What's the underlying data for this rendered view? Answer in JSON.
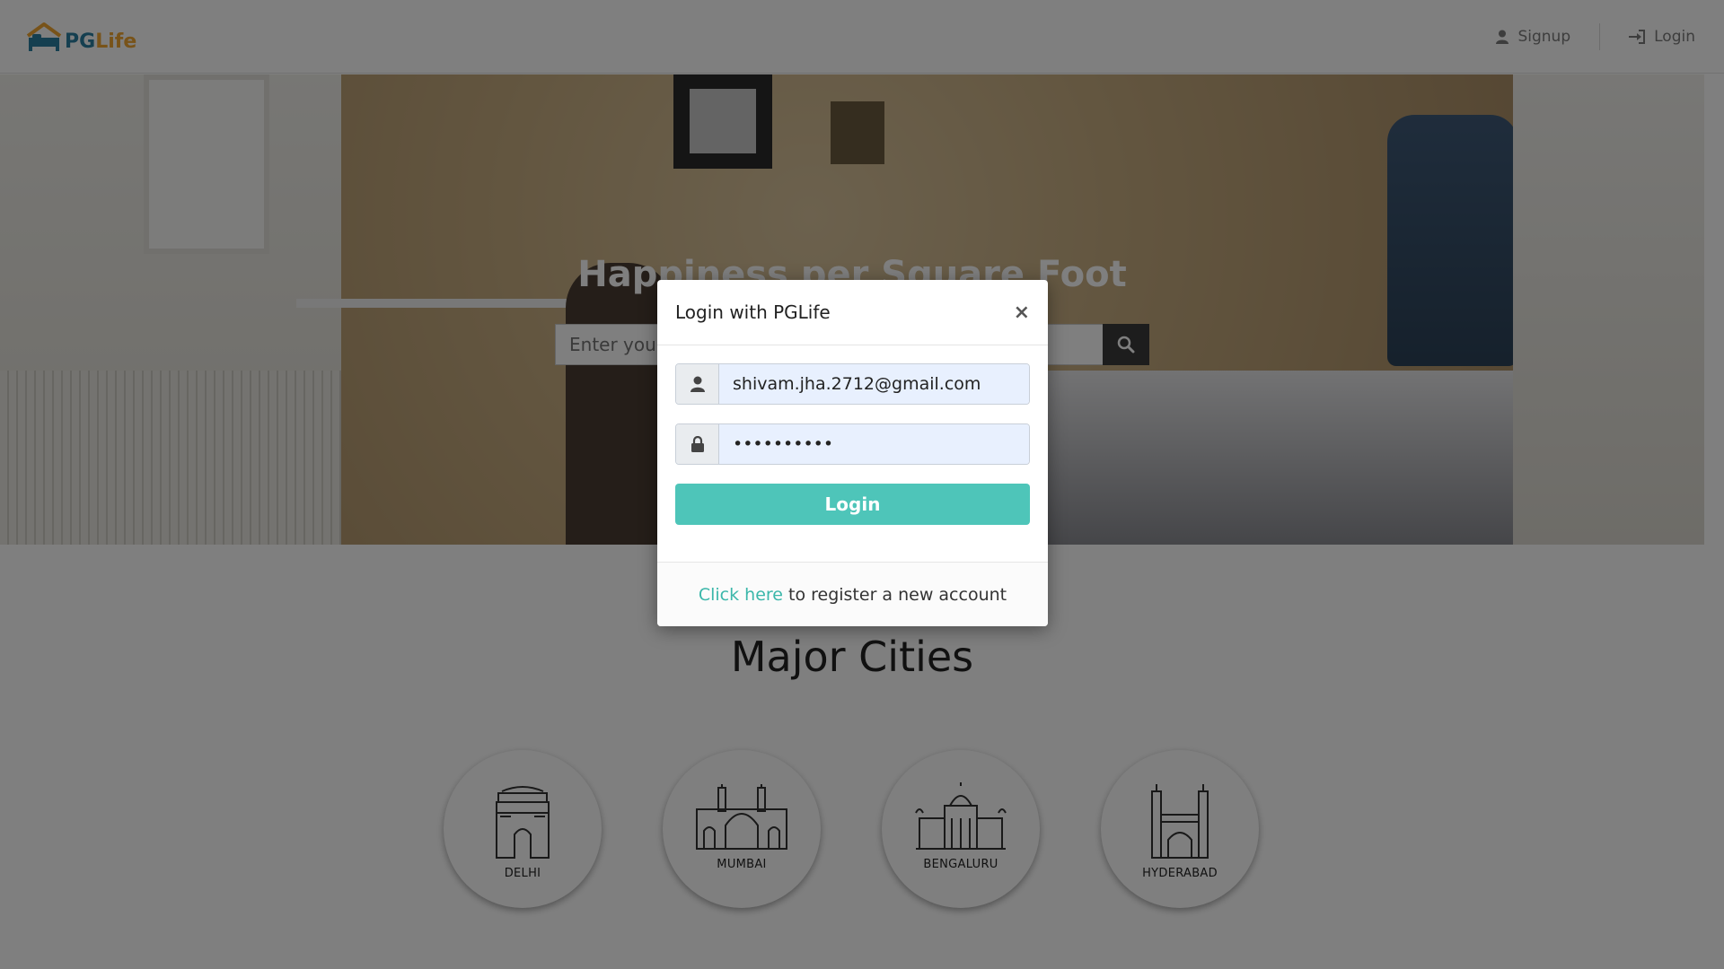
{
  "header": {
    "logo_pg": "PG",
    "logo_life": "Life",
    "nav": {
      "signup_label": "Signup",
      "login_label": "Login"
    }
  },
  "banner": {
    "title": "Happiness per Square Foot",
    "search_placeholder": "Enter your"
  },
  "cities": {
    "title": "Major Cities",
    "items": [
      {
        "label": "DELHI"
      },
      {
        "label": "MUMBAI"
      },
      {
        "label": "BENGALURU"
      },
      {
        "label": "HYDERABAD"
      }
    ]
  },
  "modal": {
    "title": "Login with PGLife",
    "close_label": "×",
    "email_value": "shivam.jha.2712@gmail.com",
    "password_value": "••••••••••",
    "login_button": "Login",
    "footer_link": "Click here",
    "footer_text": "to register a new account"
  },
  "colors": {
    "brand_teal": "#4ec5b9",
    "link_teal": "#3bb7aa",
    "logo_blue": "#2b7ea1",
    "logo_orange": "#f0a732",
    "overlay": "rgba(0,0,0,0.5)"
  },
  "icons": {
    "logo": "house-bed-logo-icon",
    "signup": "user-icon",
    "login": "sign-in-icon",
    "search": "search-icon",
    "email_field": "user-icon",
    "password_field": "lock-icon"
  }
}
